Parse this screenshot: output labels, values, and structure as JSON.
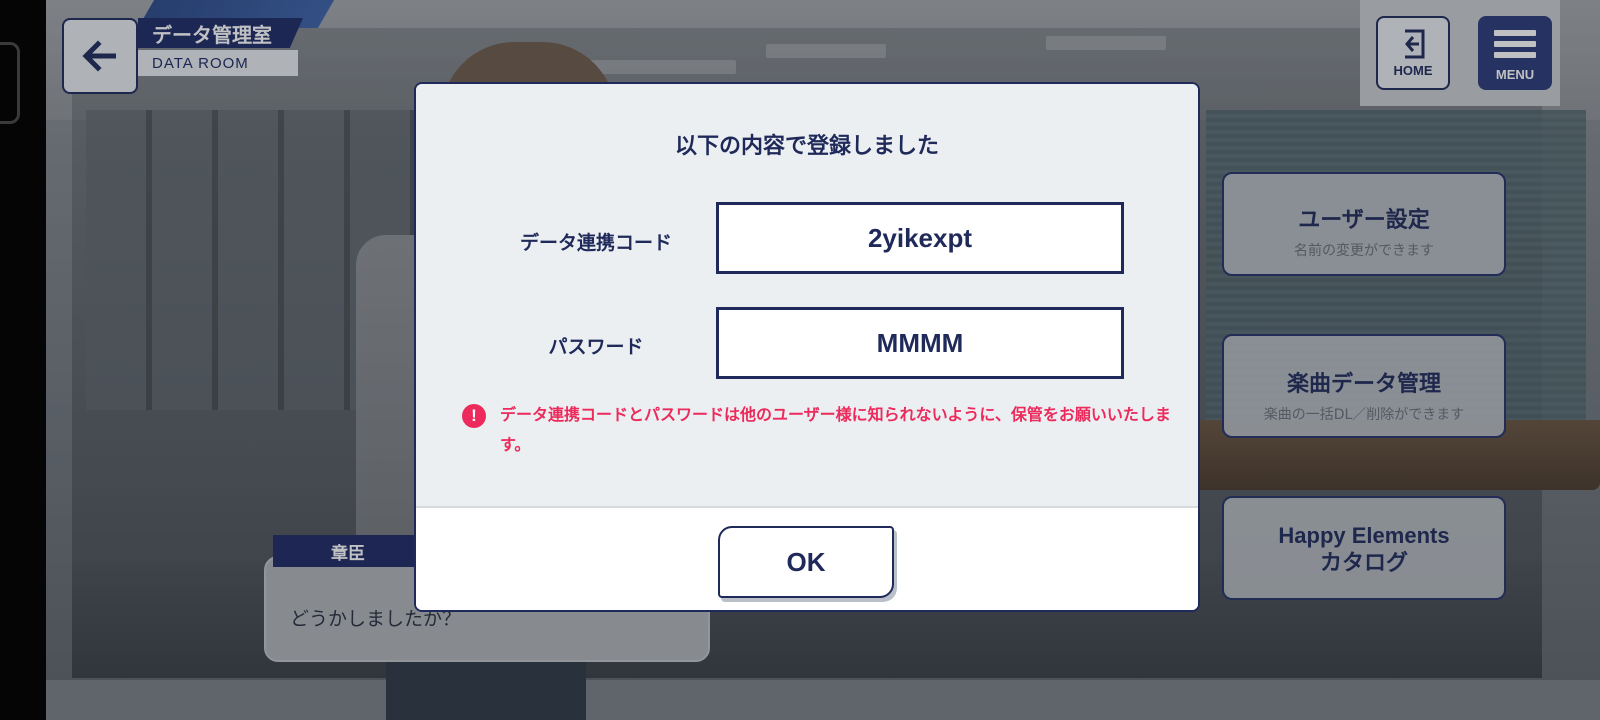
{
  "header": {
    "title_jp": "データ管理室",
    "title_en": "DATA ROOM",
    "back_icon": "arrow-left-icon"
  },
  "top_buttons": {
    "home_label": "HOME",
    "home_icon": "exit-door-icon",
    "menu_label": "MENU",
    "menu_icon": "hamburger-icon"
  },
  "side_menu": {
    "items": [
      {
        "label": "ユーザー設定",
        "sub": "名前の変更ができます"
      },
      {
        "label": "楽曲データ管理",
        "sub": "楽曲の一括DL／削除ができます"
      },
      {
        "label_line1": "Happy Elements",
        "label_line2": "カタログ"
      }
    ]
  },
  "dialogue": {
    "speaker": "章臣",
    "text": "どうかしましたか？"
  },
  "modal": {
    "title": "以下の内容で登録しました",
    "code_label": "データ連携コード",
    "code_value": "2yikexpt",
    "password_label": "パスワード",
    "password_value": "MMMM",
    "warning_icon": "exclamation-circle-icon",
    "warning_text": "データ連携コードとパスワードは他のユーザー様に知られないように、保管をお願いいたします。",
    "ok_label": "OK"
  },
  "colors": {
    "navy": "#1f2a5a",
    "warning": "#ec2a5c",
    "menu_bg": "#2a3a78"
  }
}
